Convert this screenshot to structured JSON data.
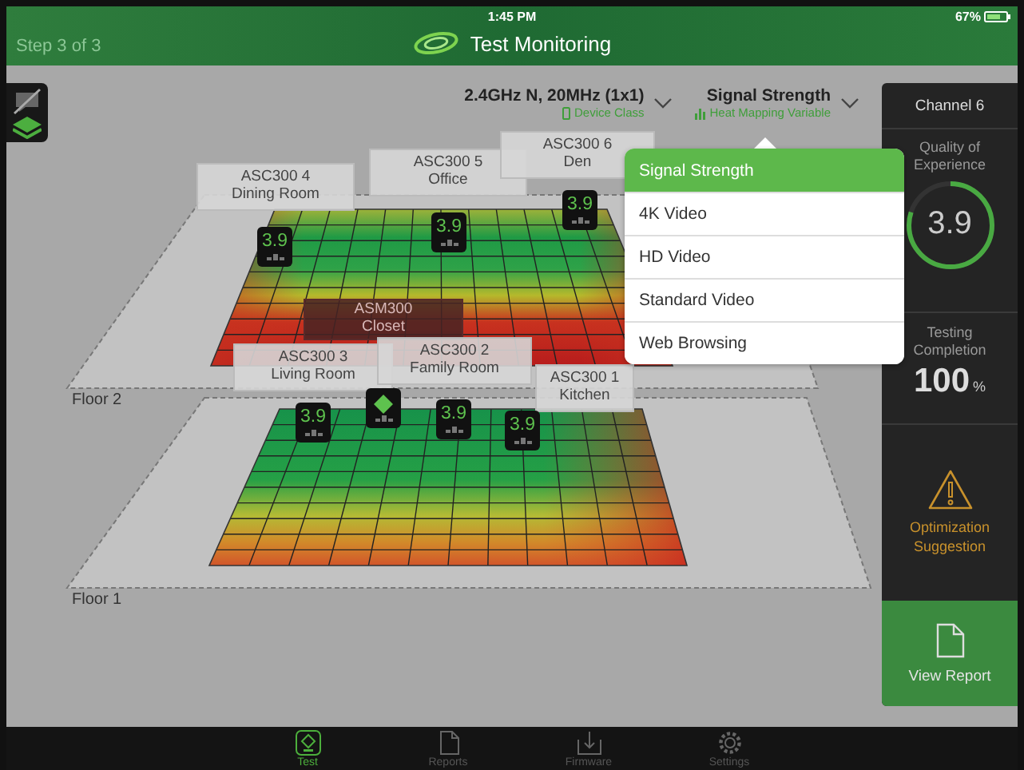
{
  "status_bar": {
    "time": "1:45 PM",
    "battery": "67%"
  },
  "header": {
    "step": "Step 3 of 3",
    "title": "Test Monitoring"
  },
  "selectors": [
    {
      "value": "2.4GHz N, 20MHz (1x1)",
      "caption": "Device Class"
    },
    {
      "value": "Signal Strength",
      "caption": "Heat Mapping Variable"
    }
  ],
  "floors": [
    {
      "label": "Floor 2",
      "devices": [
        {
          "kind": "sensor",
          "name": "ASC300 4",
          "room": "Dining Room",
          "reading": "3.9"
        },
        {
          "kind": "sensor",
          "name": "ASC300 5",
          "room": "Office",
          "reading": "3.9"
        },
        {
          "kind": "sensor",
          "name": "ASC300 6",
          "room": "Den",
          "reading": "3.9"
        }
      ]
    },
    {
      "label": "Floor 1",
      "devices": [
        {
          "kind": "monitor",
          "name": "ASM300",
          "room": "Closet"
        },
        {
          "kind": "sensor",
          "name": "ASC300 3",
          "room": "Living Room",
          "reading": "3.9"
        },
        {
          "kind": "sensor",
          "name": "ASC300 2",
          "room": "Family Room",
          "reading": "3.9"
        },
        {
          "kind": "sensor",
          "name": "ASC300 1",
          "room": "Kitchen",
          "reading": "3.9"
        }
      ]
    }
  ],
  "dropdown": {
    "items": [
      {
        "label": "Signal Strength",
        "selected": true
      },
      {
        "label": "4K Video",
        "selected": false
      },
      {
        "label": "HD Video",
        "selected": false
      },
      {
        "label": "Standard Video",
        "selected": false
      },
      {
        "label": "Web Browsing",
        "selected": false
      }
    ]
  },
  "panel": {
    "channel": "Channel 6",
    "qoe": {
      "label": "Quality of Experience",
      "value": "3.9",
      "level": 0.8
    },
    "completion": {
      "label": "Testing Completion",
      "value": "100",
      "unit": "%"
    },
    "suggestion": "Optimization Suggestion",
    "report": "View Report"
  },
  "tabs": [
    {
      "label": "Test",
      "selected": true
    },
    {
      "label": "Reports",
      "selected": false
    },
    {
      "label": "Firmware",
      "selected": false
    },
    {
      "label": "Settings",
      "selected": false
    }
  ]
}
